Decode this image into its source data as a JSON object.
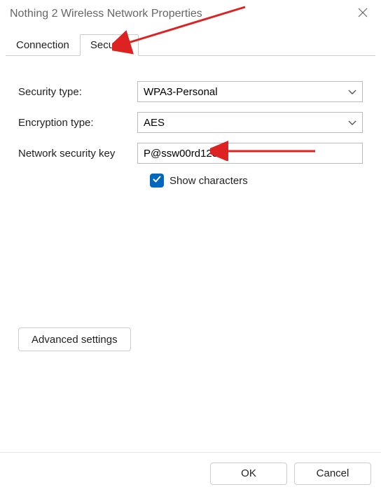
{
  "window": {
    "title": "Nothing 2 Wireless Network Properties"
  },
  "tabs": {
    "connection": "Connection",
    "security": "Security"
  },
  "form": {
    "security_type_label": "Security type:",
    "security_type_value": "WPA3-Personal",
    "encryption_type_label": "Encryption type:",
    "encryption_type_value": "AES",
    "network_key_label": "Network security key",
    "network_key_value": "P@ssw00rd123",
    "show_characters_label": "Show characters"
  },
  "buttons": {
    "advanced": "Advanced settings",
    "ok": "OK",
    "cancel": "Cancel"
  }
}
